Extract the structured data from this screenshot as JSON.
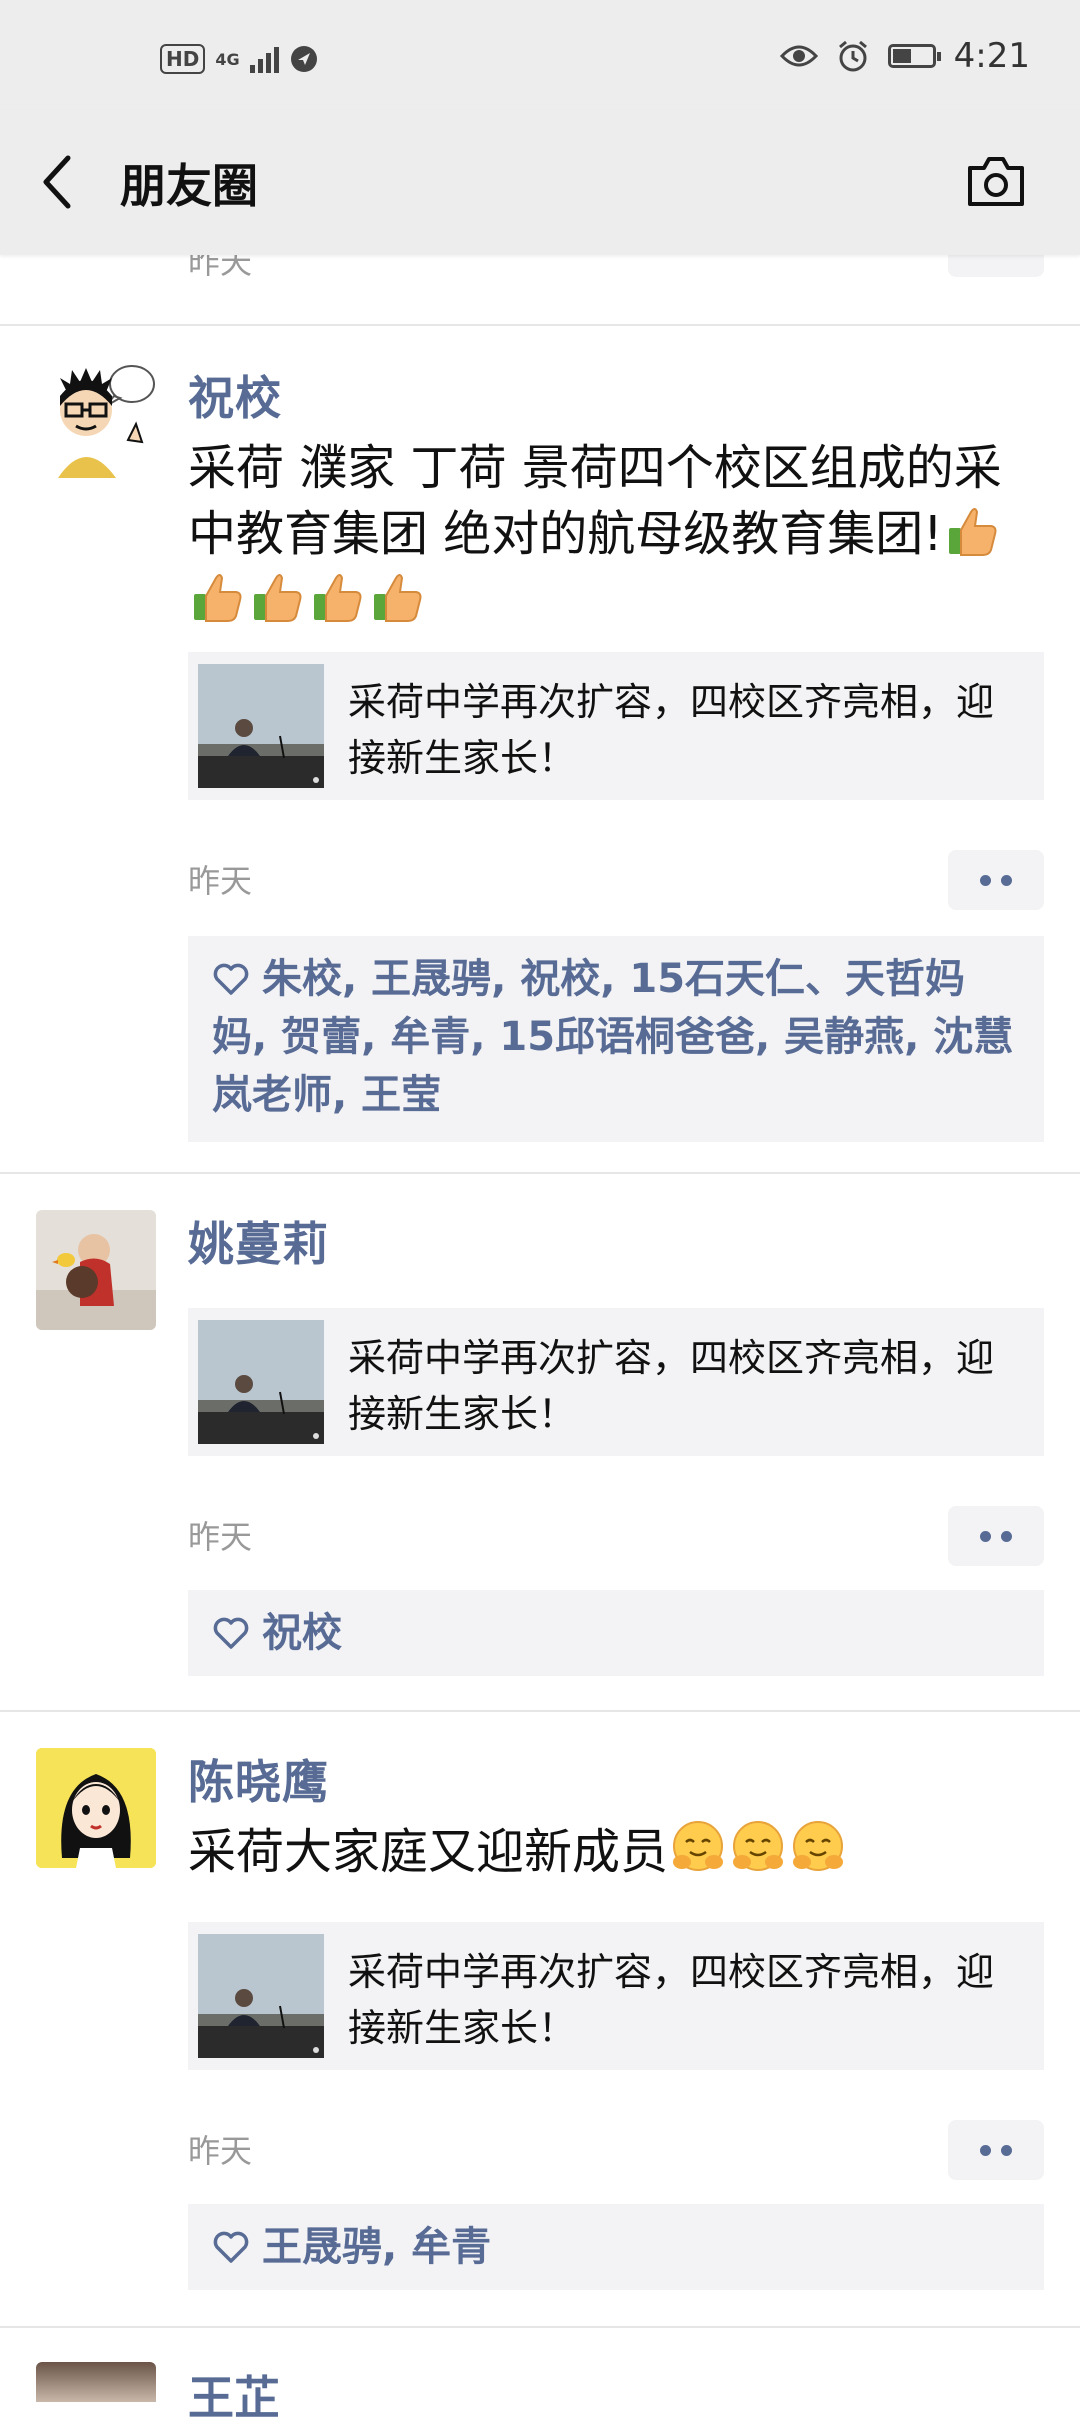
{
  "status_bar": {
    "hd": "HD",
    "network": "4G",
    "time": "4:21"
  },
  "nav": {
    "title": "朋友圈",
    "back_icon": "chevron-left-icon",
    "camera_icon": "camera-icon"
  },
  "previous_post": {
    "time": "昨天"
  },
  "posts": [
    {
      "author": "祝校",
      "text": "采荷  濮家  丁荷  景荷四个校区组成的采中教育集团 绝对的航母级教育集团!",
      "emoji": "thumbs-up-emoji",
      "emoji_count": 5,
      "link_title": "采荷中学再次扩容，四校区齐亮相，迎接新生家长！",
      "time": "昨天",
      "likes": "朱校, 王晟骋, 祝校, 15石天仁、天哲妈妈, 贺蕾, 牟青, 15邱语桐爸爸, 吴静燕, 沈慧岚老师, 王莹"
    },
    {
      "author": "姚蔓莉",
      "text": "",
      "link_title": "采荷中学再次扩容，四校区齐亮相，迎接新生家长！",
      "time": "昨天",
      "likes": "祝校"
    },
    {
      "author": "陈晓鹰",
      "text": "采荷大家庭又迎新成员",
      "emoji": "hugging-face-emoji",
      "emoji_count": 3,
      "link_title": "采荷中学再次扩容，四校区齐亮相，迎接新生家长！",
      "time": "昨天",
      "likes": "王晟骋, 牟青"
    }
  ],
  "next_post": {
    "author": "王芷"
  },
  "colors": {
    "link_blue": "#576b95",
    "bar_bg": "#ededed",
    "card_bg": "#f3f3f5",
    "time_gray": "#999999"
  }
}
